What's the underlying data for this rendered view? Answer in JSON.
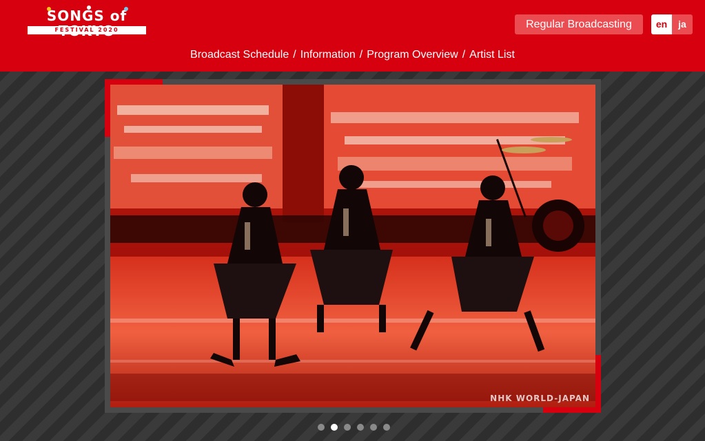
{
  "header": {
    "logo": {
      "main": "SONGS of TOKYO",
      "sub": "FESTIVAL 2020"
    },
    "regular_broadcasting": "Regular Broadcasting",
    "languages": [
      {
        "label": "en",
        "active": true
      },
      {
        "label": "ja",
        "active": false
      }
    ],
    "nav": [
      "Broadcast Schedule",
      "Information",
      "Program Overview",
      "Artist List"
    ],
    "nav_separator": "/"
  },
  "slider": {
    "watermark": "NHK WORLD-JAPAN",
    "slide_count": 6,
    "active_slide": 2
  },
  "colors": {
    "brand_red": "#d6000f",
    "button_red": "#ea4c51"
  }
}
